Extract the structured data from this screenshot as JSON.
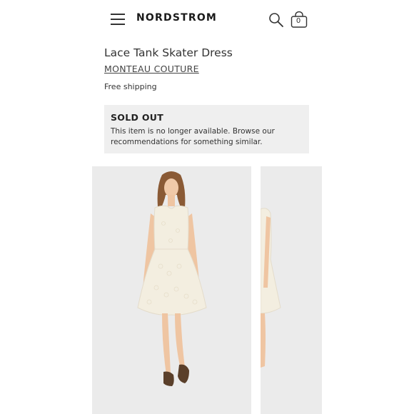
{
  "header": {
    "logo": "NORDSTROM",
    "bag_count": "0",
    "icons": {
      "menu": "hamburger-menu-icon",
      "search": "search-icon",
      "bag": "shopping-bag-icon"
    }
  },
  "product": {
    "title": "Lace Tank Skater Dress",
    "brand": "MONTEAU COUTURE",
    "shipping": "Free shipping"
  },
  "sold_out": {
    "title": "SOLD OUT",
    "message": "This item is no longer available. Browse our recommendations for something similar."
  },
  "colors": {
    "accent_text": "#262626",
    "notice_bg": "#efefef",
    "photo_bg": "#ebebeb",
    "dress": "#f3eee0"
  }
}
